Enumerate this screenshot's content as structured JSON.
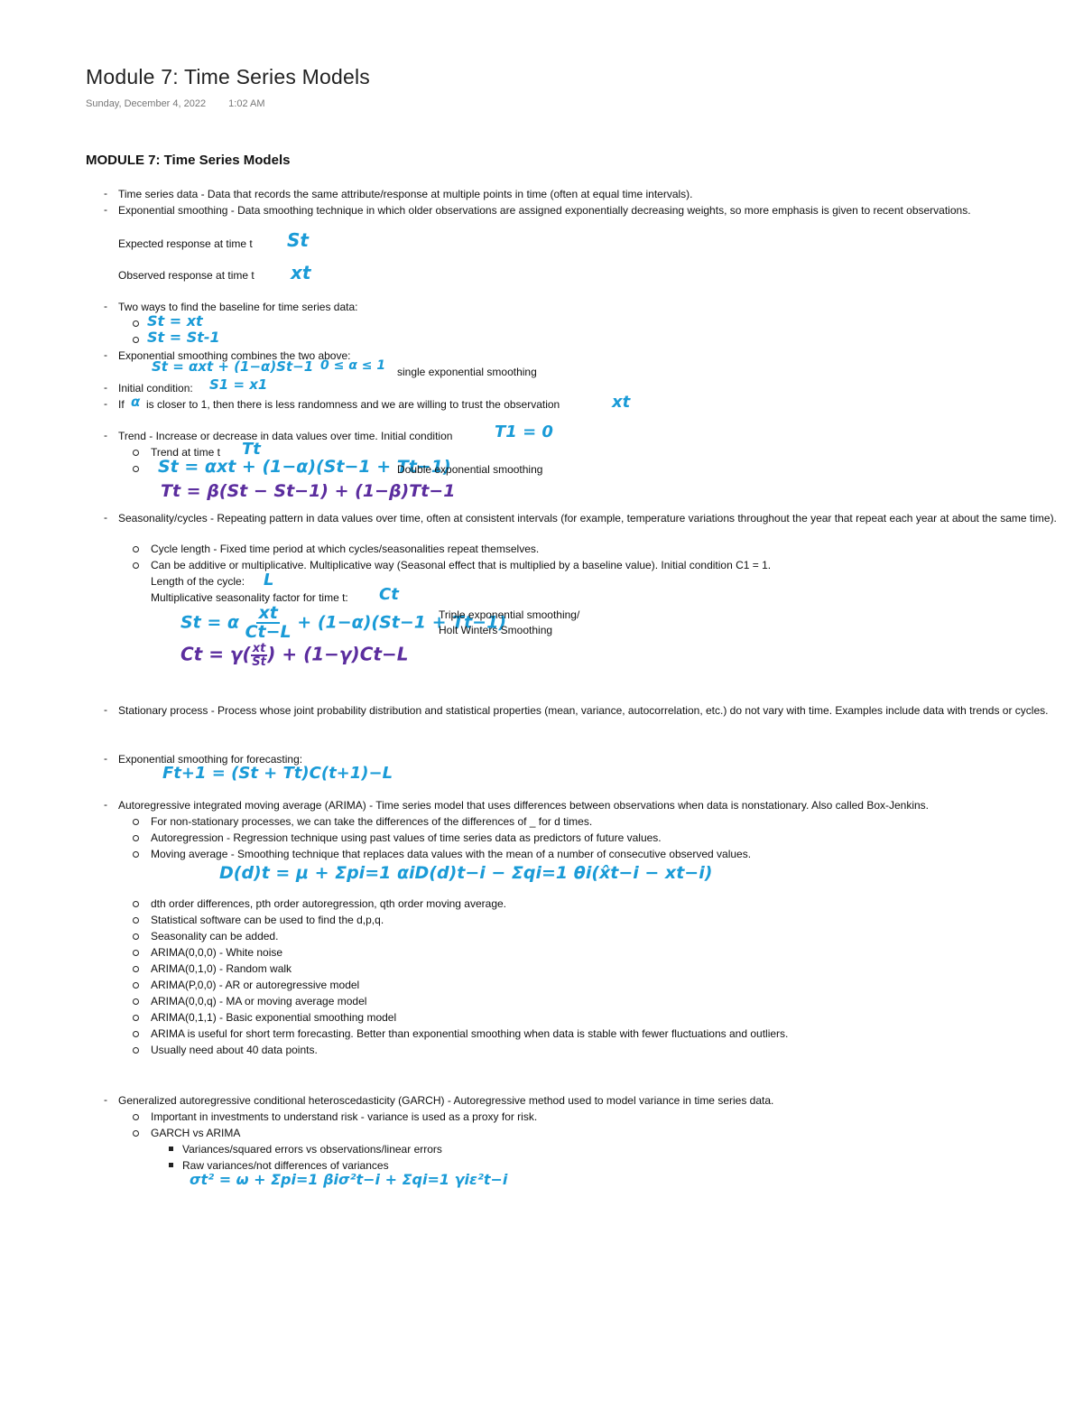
{
  "page": {
    "title": "Module 7: Time Series Models",
    "date": "Sunday, December 4, 2022",
    "time": "1:02 AM",
    "heading": "MODULE 7: Time Series Models"
  },
  "colors": {
    "ink_blue": "#1a9bd7",
    "ink_purple": "#5b2d9e"
  },
  "notes": {
    "time_series": "Time series data - Data that records the same attribute/response at multiple points in time (often at equal time intervals).",
    "exp_smoothing": "Exponential smoothing - Data smoothing technique in which older observations are assigned exponentially decreasing weights, so more emphasis is given to recent observations.",
    "expected_label": "Expected response at time t",
    "expected_sym": "St",
    "observed_label": "Observed response at time t",
    "observed_sym": "xt",
    "two_ways": "Two ways to find the baseline for time series data:",
    "way1": "St = xt",
    "way2": "St = St-1",
    "combines": "Exponential smoothing combines the two above:",
    "single_formula": "St = αxt + (1−α)St−1",
    "alpha_range": "0 ≤ α ≤ 1",
    "single_label": "single exponential smoothing",
    "initial_label": "Initial condition:",
    "initial_formula": "S1 = x1",
    "if_prefix": "If",
    "alpha_sym": "α",
    "if_rest": "is closer to 1, then there is less randomness and we are willing to trust the observation",
    "if_sym": "xt",
    "trend": "Trend - Increase or decrease in data values over time. Initial condition",
    "trend_init": "T1 = 0",
    "trend_at": "Trend at time t",
    "trend_sym": "Tt",
    "double_s": "St = αxt + (1−α)(St−1 + Tt−1)",
    "double_label": "Double exponential smoothing",
    "double_t": "Tt = β(St − St−1) + (1−β)Tt−1",
    "seasonality": "Seasonality/cycles - Repeating pattern in data values over time, often at consistent intervals (for example, temperature variations throughout the year that repeat each year at about the same time).",
    "cycle_length": "Cycle length - Fixed time period at which cycles/seasonalities repeat themselves.",
    "additive": "Can be additive or multiplicative. Multiplicative way (Seasonal effect that is multiplied by a baseline value). Initial condition C1 = 1.",
    "length_label": "Length of the cycle:",
    "length_sym": "L",
    "mult_label": "Multiplicative seasonality factor for time t:",
    "mult_sym": "Ct",
    "triple_s_a": "St = α",
    "triple_s_num": "xt",
    "triple_s_den": "Ct−L",
    "triple_s_b": "+ (1−α)(St−1 + Tt−1)",
    "triple_c_a": "Ct = γ(",
    "triple_c_num": "xt",
    "triple_c_den": "St",
    "triple_c_b": ") + (1−γ)Ct−L",
    "triple_label1": "Triple exponential smoothing/",
    "triple_label2": "Holt Winters Smoothing",
    "stationary": "Stationary process - Process whose joint probability distribution and statistical properties (mean, variance, autocorrelation, etc.) do not vary with time. Examples include data with trends or cycles.",
    "forecast": "Exponential smoothing for forecasting:",
    "forecast_formula": "Ft+1 = (St + Tt)C(t+1)−L",
    "arima": "Autoregressive integrated moving average (ARIMA) - Time series model that uses differences between observations when data is nonstationary. Also called Box-Jenkins.",
    "arima_items": [
      "For non-stationary processes, we can take the differences of the differences of _ for d times.",
      "Autoregression - Regression technique using past values of time series data as predictors of future values.",
      "Moving average - Smoothing technique that replaces data values with the mean of a number of consecutive observed values."
    ],
    "arima_formula": "D(d)t = μ + Σpi=1 αiD(d)t−i − Σqi=1 θi(x̂t−i − xt−i)",
    "arima_items2": [
      "dth order differences, pth order autoregression, qth order moving average.",
      "Statistical software can be used to find the d,p,q.",
      "Seasonality can be added.",
      "ARIMA(0,0,0) - White noise",
      "ARIMA(0,1,0) - Random walk",
      "ARIMA(P,0,0) - AR or autoregressive model",
      "ARIMA(0,0,q) - MA or moving average model",
      "ARIMA(0,1,1) - Basic exponential smoothing model",
      "ARIMA is useful for short term forecasting. Better than exponential smoothing when data is stable with fewer fluctuations and outliers.",
      "Usually need about 40 data points."
    ],
    "garch": "Generalized autoregressive conditional heteroscedasticity (GARCH) - Autoregressive method used to model variance in time series data.",
    "garch_important": "Important in investments to understand risk - variance is used as a proxy for risk.",
    "garch_vs": "GARCH vs ARIMA",
    "garch_sub": [
      "Variances/squared errors vs observations/linear errors",
      "Raw variances/not differences of variances"
    ],
    "garch_formula": "σt² = ω + Σpi=1 βiσ²t−i + Σqi=1 γiε²t−i"
  }
}
